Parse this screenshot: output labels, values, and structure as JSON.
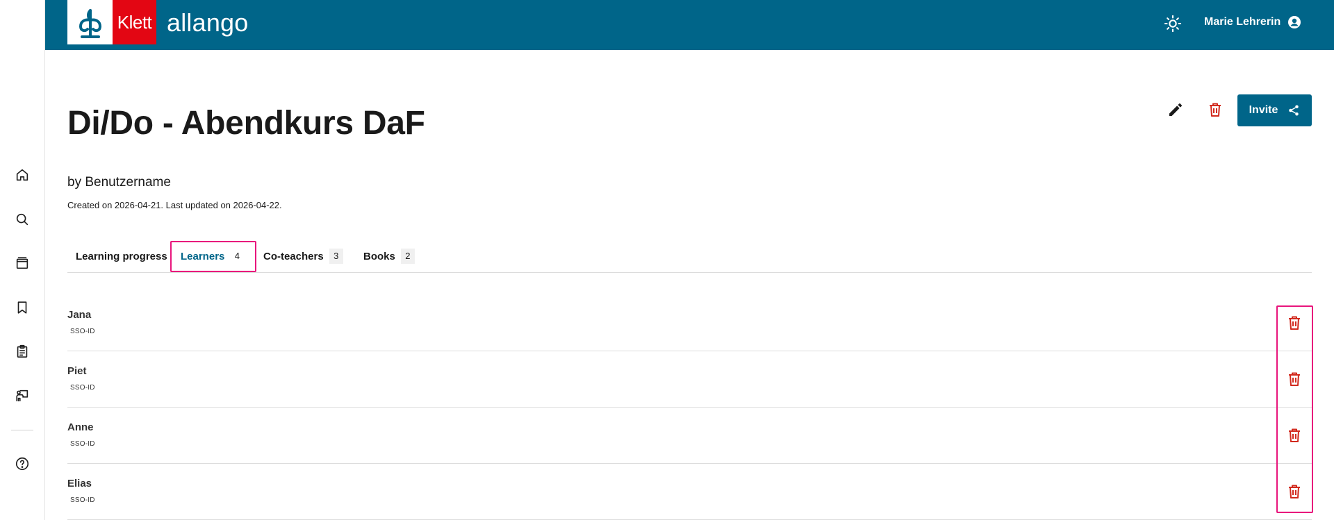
{
  "header": {
    "logo_text": "Klett",
    "brand": "allango",
    "user_name": "Marie Lehrerin",
    "colors": {
      "bar": "#006589",
      "logo_red": "#e30613"
    }
  },
  "sidebar": {
    "items": [
      {
        "icon": "home-icon"
      },
      {
        "icon": "search-icon"
      },
      {
        "icon": "library-icon"
      },
      {
        "icon": "bookmark-icon"
      },
      {
        "icon": "clipboard-icon"
      },
      {
        "icon": "teacher-icon"
      },
      {
        "icon": "help-icon"
      }
    ]
  },
  "course": {
    "title": "Di/Do - Abendkurs DaF",
    "byline": "by Benutzername",
    "dates": "Created on 2026-04-21. Last updated on 2026-04-22.",
    "invite_label": "Invite"
  },
  "tabs": [
    {
      "label": "Learning progress",
      "count": ""
    },
    {
      "label": "Learners",
      "count": "4",
      "active": true
    },
    {
      "label": "Co-teachers",
      "count": "3"
    },
    {
      "label": "Books",
      "count": "2"
    }
  ],
  "learners": [
    {
      "name": "Jana",
      "id_label": "SSO-ID"
    },
    {
      "name": "Piet",
      "id_label": "SSO-ID"
    },
    {
      "name": "Anne",
      "id_label": "SSO-ID"
    },
    {
      "name": "Elias",
      "id_label": "SSO-ID"
    }
  ],
  "colors": {
    "delete": "#d22a1e",
    "highlight": "#e8157c",
    "accent": "#006589"
  }
}
